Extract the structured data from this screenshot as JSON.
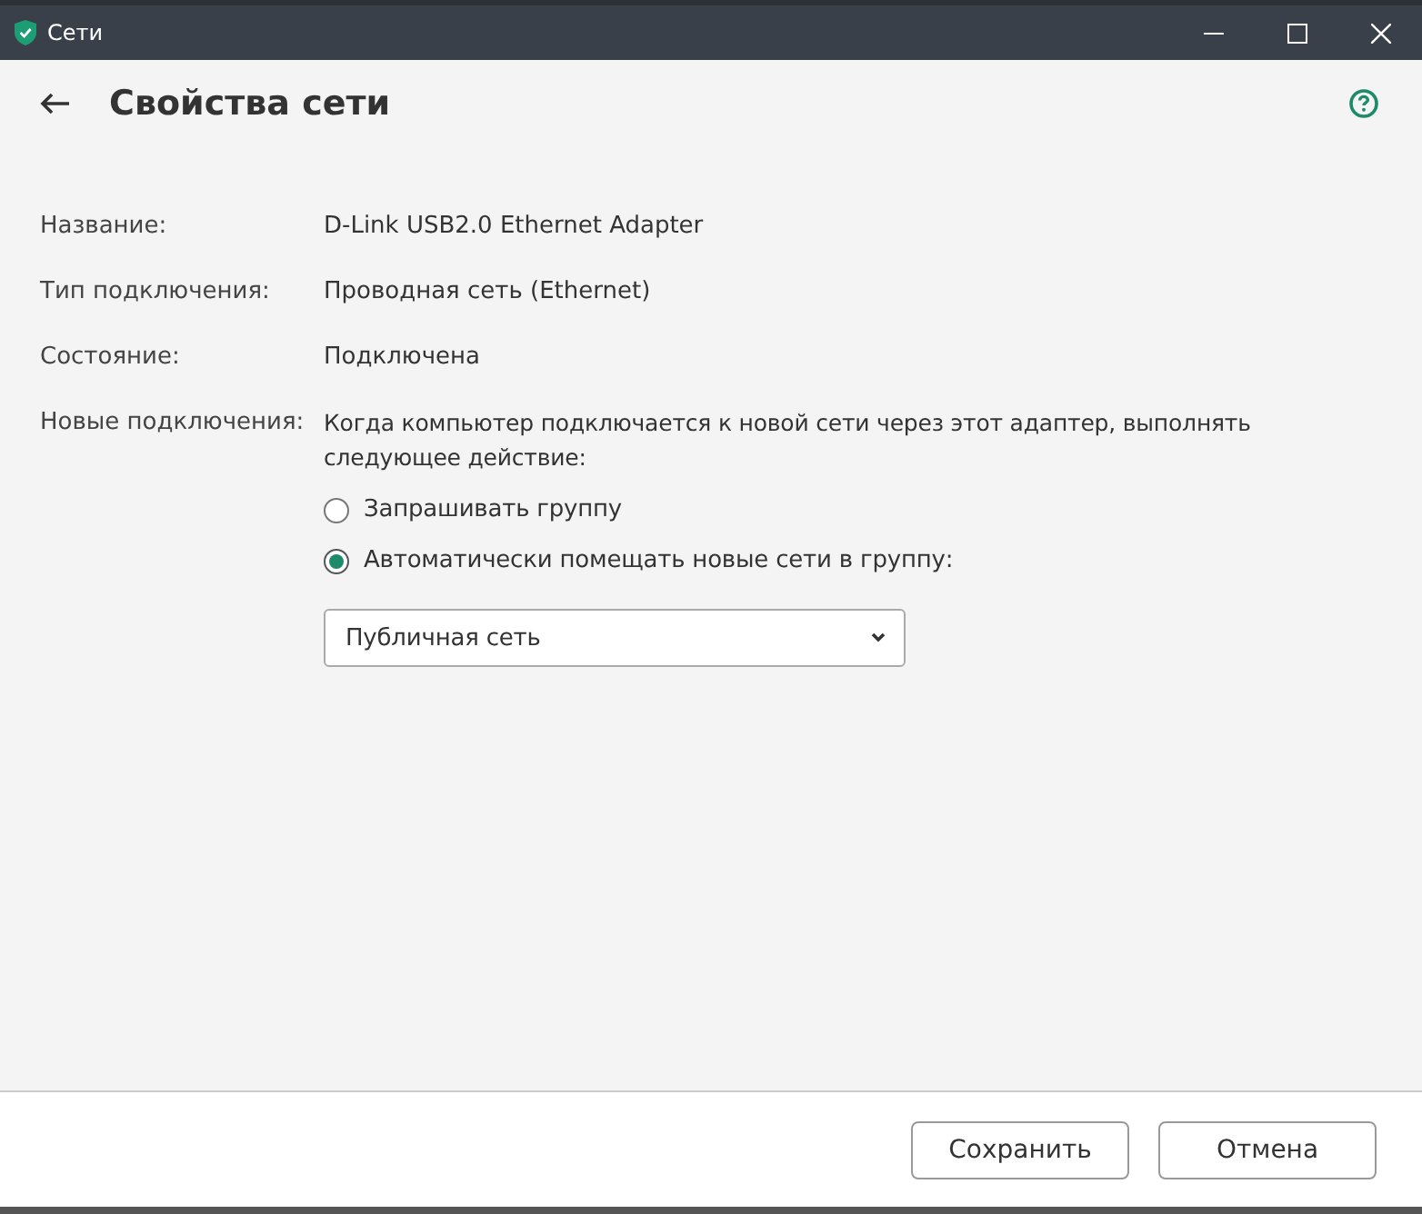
{
  "window": {
    "title": "Сети"
  },
  "page": {
    "title": "Свойства сети"
  },
  "properties": [
    {
      "label": "Название:",
      "value": "D-Link USB2.0 Ethernet Adapter"
    },
    {
      "label": "Тип подключения:",
      "value": "Проводная сеть (Ethernet)"
    },
    {
      "label": "Состояние:",
      "value": "Подключена"
    }
  ],
  "new_connections": {
    "label": "Новые подключения:",
    "description": "Когда компьютер подключается к новой сети через этот адаптер, выполнять следующее действие:",
    "options": [
      {
        "label": "Запрашивать группу",
        "selected": false
      },
      {
        "label": "Автоматически помещать новые сети в группу:",
        "selected": true
      }
    ],
    "group_dropdown": {
      "value": "Публичная сеть"
    }
  },
  "buttons": [
    {
      "label": "Сохранить"
    },
    {
      "label": "Отмена"
    }
  ]
}
